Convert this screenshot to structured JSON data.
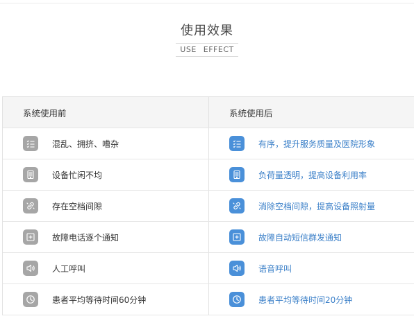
{
  "section": {
    "title": "使用效果",
    "subtitle": "USE  EFFECT"
  },
  "table": {
    "before_header": "系统使用前",
    "after_header": "系统使用后",
    "rows": [
      {
        "icon": "list-icon",
        "before": "混乱、拥挤、嘈杂",
        "after": "有序，提升服务质量及医院形象"
      },
      {
        "icon": "tablet-icon",
        "before": "设备忙闲不均",
        "after": "负荷量透明，提高设备利用率"
      },
      {
        "icon": "broken-link-icon",
        "before": "存在空档间隙",
        "after": "消除空档间隙，提高设备照射量"
      },
      {
        "icon": "add-note-icon",
        "before": "故障电话逐个通知",
        "after": "故障自动短信群发通知"
      },
      {
        "icon": "speaker-icon",
        "before": "人工呼叫",
        "after": "语音呼叫"
      },
      {
        "icon": "clock-icon",
        "before": "患者平均等待时间60分钟",
        "after": "患者平均等待时间20分钟"
      }
    ]
  },
  "colors": {
    "before_icon": "#a6a6a6",
    "after_icon": "#4a90d9",
    "after_text": "#3a7fc8"
  }
}
